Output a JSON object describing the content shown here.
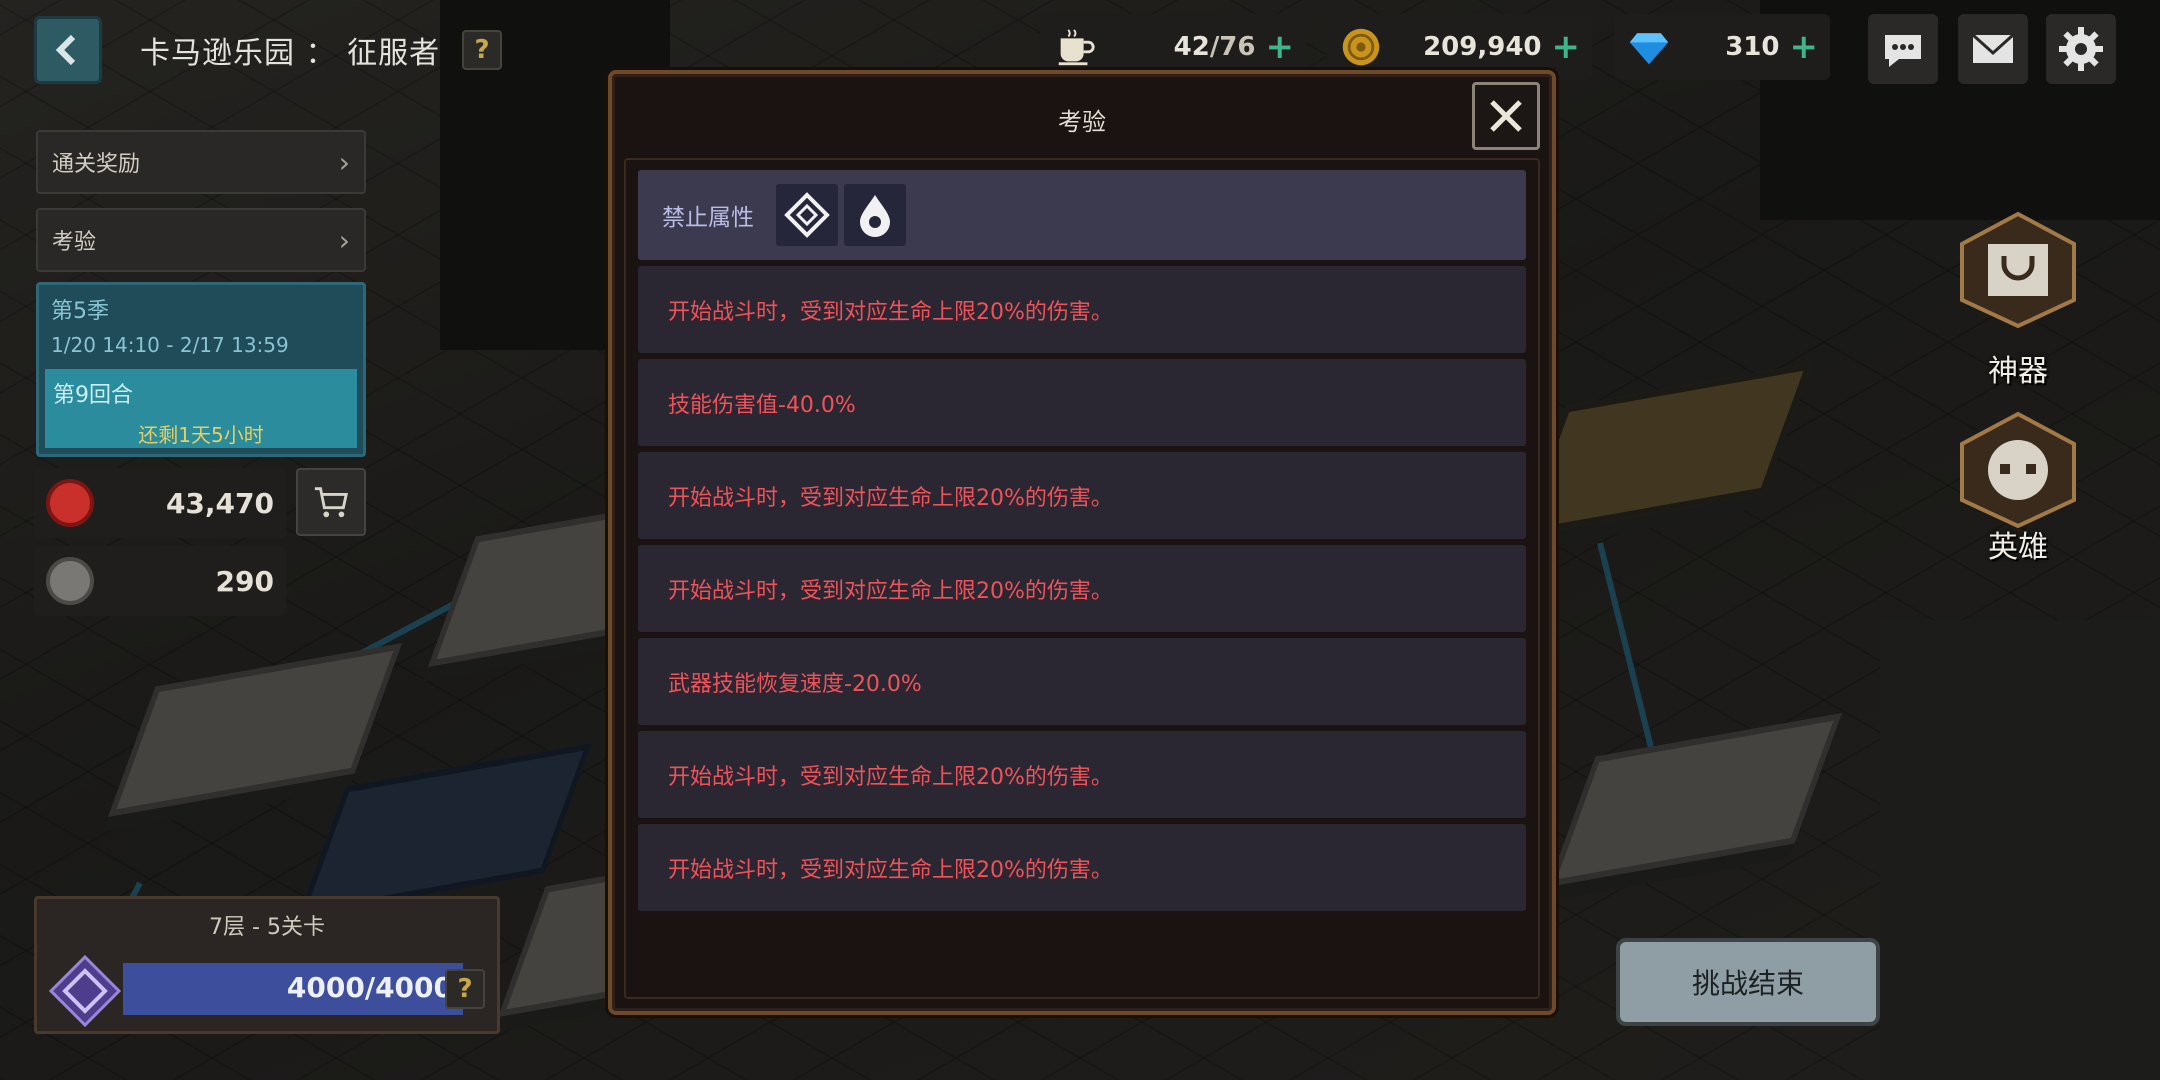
{
  "header": {
    "stage_title": "卡马逊乐园 ： 征服者",
    "help_label": "?"
  },
  "resources": {
    "stamina_current": "42",
    "stamina_max": "/76",
    "gold": "209,940",
    "gems": "310",
    "plus": "+"
  },
  "sidebar": {
    "clear_rewards": "通关奖励",
    "trial": "考验",
    "chevron": "›",
    "season_title": "第5季",
    "season_time": "1/20 14:10 - 2/17 13:59",
    "round_title": "第9回合",
    "round_remaining": "还剩1天5小时",
    "currency_red": "43,470",
    "currency_gray": "290"
  },
  "floor": {
    "title": "7层 - 5关卡",
    "progress_text": "4000/4000",
    "progress_fraction": 1.0,
    "help_label": "?"
  },
  "right": {
    "artifact_label": "神器",
    "hero_label": "英雄",
    "end_challenge_label": "挑战结束"
  },
  "modal": {
    "title": "考验",
    "forbidden_label": "禁止属性",
    "forbidden_icons": [
      "basic-element-icon",
      "water-drop-icon"
    ],
    "trials": [
      "开始战斗时，受到对应生命上限20%的伤害。",
      "技能伤害值-40.0%",
      "开始战斗时，受到对应生命上限20%的伤害。",
      "开始战斗时，受到对应生命上限20%的伤害。",
      "武器技能恢复速度-20.0%",
      "开始战斗时，受到对应生命上限20%的伤害。",
      "开始战斗时，受到对应生命上限20%的伤害。"
    ]
  },
  "colors": {
    "trial_text": "#f05259",
    "forbid_label": "#b9bde6",
    "modal_border": "#6e4a2a",
    "teal": "#2a8c9d",
    "progress_fill": "#3d4f9c",
    "plus": "#3fb58a"
  }
}
